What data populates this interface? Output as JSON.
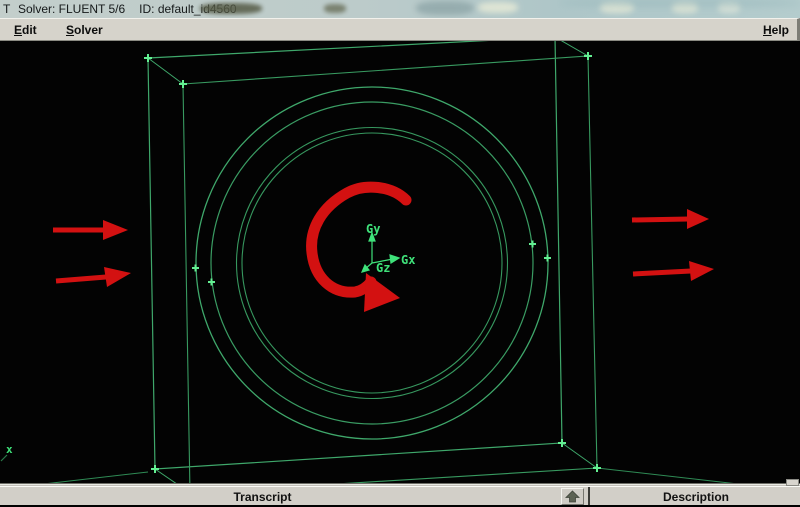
{
  "window": {
    "title_fragment": "T",
    "solver_label": "Solver: FLUENT 5/6",
    "id_label": "ID: default_id4560"
  },
  "menu": {
    "edit": "Edit",
    "solver": "Solver",
    "help": "Help"
  },
  "viewport": {
    "axis_triad": {
      "x_label": "Gx",
      "y_label": "Gy",
      "z_label": "Gz"
    },
    "corner_axis_label": "x"
  },
  "panels": {
    "transcript_label": "Transcript",
    "description_label": "Description"
  },
  "icons": {
    "raise_panel": "up-arrow"
  },
  "colors": {
    "wireframe_green": "#3fa86b",
    "circle_green": "#3a9c63",
    "tick_green": "#63ef92",
    "axis_green": "#3fe27a",
    "annotation_red": "#d31111",
    "viewport_bg": "#030303",
    "chrome_gray": "#d2cfc8"
  }
}
